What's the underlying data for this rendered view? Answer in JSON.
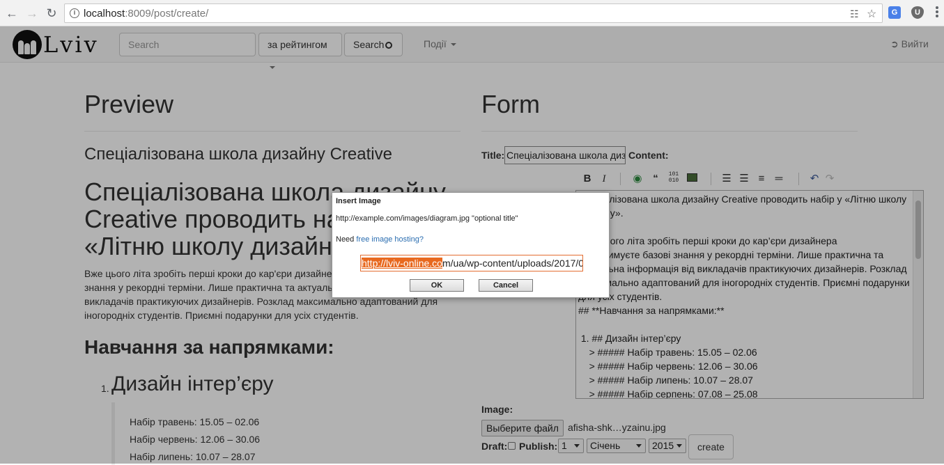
{
  "browser": {
    "url_host": "localhost",
    "url_rest": ":8009/post/create/"
  },
  "navbar": {
    "logo_text": "Lviv",
    "search_placeholder": "Search",
    "sort_label": "за рейтингом",
    "search_button": "Search",
    "events_label": "Події",
    "logout_label": "Вийти"
  },
  "preview": {
    "heading": "Preview",
    "subtitle": "Спеціалізована школа дизайну Creative",
    "h1": "Спеціалізована школа дизайну Creative проводить набір у «Літню школу дизайну»",
    "paragraph": "Вже цього літа зробіть перші кроки до кар'єри дизайнера. Ви отримуєте базові знання у рекордні терміни. Лише практична та актуальна інформація від викладачів практикуючих дизайнерів. Розклад максимально адаптований для іногородніх студентів. Приємні подарунки для усіх студентів.",
    "h2": "Навчання за напрямками:",
    "list_num": "1.",
    "list_item": "Дизайн інтер’єру",
    "quotes": [
      "Набір травень: 15.05 – 02.06",
      "Набір червень: 12.06 – 30.06",
      "Набір липень: 10.07 – 28.07"
    ]
  },
  "form": {
    "heading": "Form",
    "title_label": "Title:",
    "title_value": "Спеціалізована школа дизайну Creative",
    "content_label": "Content:",
    "image_label": "Image:",
    "file_button": "Выберите файл",
    "file_name": "afisha-shk…yzainu.jpg",
    "draft_label": "Draft:",
    "publish_label": "Publish:",
    "day": "1",
    "month": "Січень",
    "year": "2015",
    "create_button": "create"
  },
  "editor": {
    "line1": "Спеціалізована школа дизайну Creative проводить набір у «Літню школу дизайну».",
    "line2": "Вже цього літа зробіть перші кроки до кар’єри дизайнера",
    "line3": "Ви отримуєте базові знання у рекордні терміни. Лише практична та актуальна інформація від викладачів практикуючих дизайнерів. Розклад максимально адаптований для іногородніх студентів. Приємні подарунки для усіх студентів.",
    "line4": "## **Навчання за напрямками:**",
    "line5": " 1. ## Дизайн інтер’єру",
    "line6": "    > ##### Набір травень: 15.05 – 02.06",
    "line7": "    > ##### Набір червень: 12.06 – 30.06",
    "line8": "    > ##### Набір липень: 10.07 – 28.07",
    "line9": "    > ##### Набір серпень: 07.08 – 25.08"
  },
  "dialog": {
    "title": "Insert Image",
    "hint": "http://example.com/images/diagram.jpg \"optional title\"",
    "need_text": "Need ",
    "need_link": "free image hosting?",
    "input_highlight": "http://lviv-online.co",
    "input_rest": "m/ua/wp-content/uploads/2017/0",
    "ok": "OK",
    "cancel": "Cancel"
  }
}
